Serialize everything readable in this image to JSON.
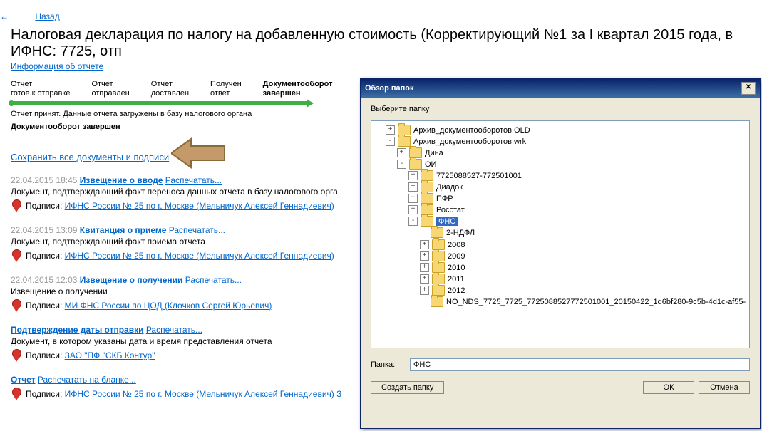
{
  "back": "Назад",
  "title": "Налоговая декларация по налогу на добавленную стоимость (Корректирующий №1 за I квартал 2015 года, в ИФНС: 7725, отп",
  "info_link": "Информация об отчете",
  "steps": {
    "s1a": "Отчет",
    "s1b": "готов к отправке",
    "s2a": "Отчет",
    "s2b": "отправлен",
    "s3a": "Отчет",
    "s3b": "доставлен",
    "s4a": "Получен",
    "s4b": "ответ",
    "s5a": "Документооборот",
    "s5b": "завершен"
  },
  "status_line": "Отчет принят. Данные отчета загружены в базу налогового органа",
  "status_bold": "Документооборот завершен",
  "save_all": "Сохранить все документы и подписи",
  "sig_label": "Подписи:",
  "print": "Распечатать...",
  "print_blank": "Распечатать на бланке...",
  "docs": {
    "d1": {
      "ts": "22.04.2015 18:45",
      "title": "Извещение о вводе",
      "desc": "Документ, подтверждающий факт переноса данных отчета в базу налогового орга",
      "sig": "ИФНС России № 25 по г. Москве (Мельничук Алексей Геннадиевич)"
    },
    "d2": {
      "ts": "22.04.2015 13:09",
      "title": "Квитанция о приеме",
      "desc": "Документ, подтверждающий факт приема отчета",
      "sig": "ИФНС России № 25 по г. Москве (Мельничук Алексей Геннадиевич)"
    },
    "d3": {
      "ts": "22.04.2015 12:03",
      "title": "Извещение о получении",
      "desc": "Извещение о получении",
      "sig": "МИ ФНС России по ЦОД (Клочков Сергей Юрьевич)"
    },
    "d4": {
      "title": "Подтверждение даты отправки",
      "desc": "Документ, в котором указаны дата и время представления отчета",
      "sig": "ЗАО \"ПФ \"СКБ Контур\""
    },
    "d5": {
      "title": "Отчет",
      "sig": "ИФНС России № 25 по г. Москве (Мельничук Алексей Геннадиевич)",
      "extra": "З"
    }
  },
  "dlg": {
    "title": "Обзор папок",
    "prompt": "Выберите папку",
    "folder_label": "Папка:",
    "folder_value": "ФНС",
    "btn_new": "Создать папку",
    "btn_ok": "ОК",
    "btn_cancel": "Отмена",
    "tree": {
      "n1": "Архив_документооборотов.OLD",
      "n2": "Архив_документооборотов.wrk",
      "n3": "Дина",
      "n4": "ОИ",
      "n5": "7725088527-772501001",
      "n6": "Диадок",
      "n7": "ПФР",
      "n8": "Росстат",
      "n9": "ФНС",
      "n10": "2-НДФЛ",
      "n11": "2008",
      "n12": "2009",
      "n13": "2010",
      "n14": "2011",
      "n15": "2012",
      "n16": "NO_NDS_7725_7725_7725088527772501001_20150422_1d6bf280-9c5b-4d1c-af55-"
    }
  }
}
